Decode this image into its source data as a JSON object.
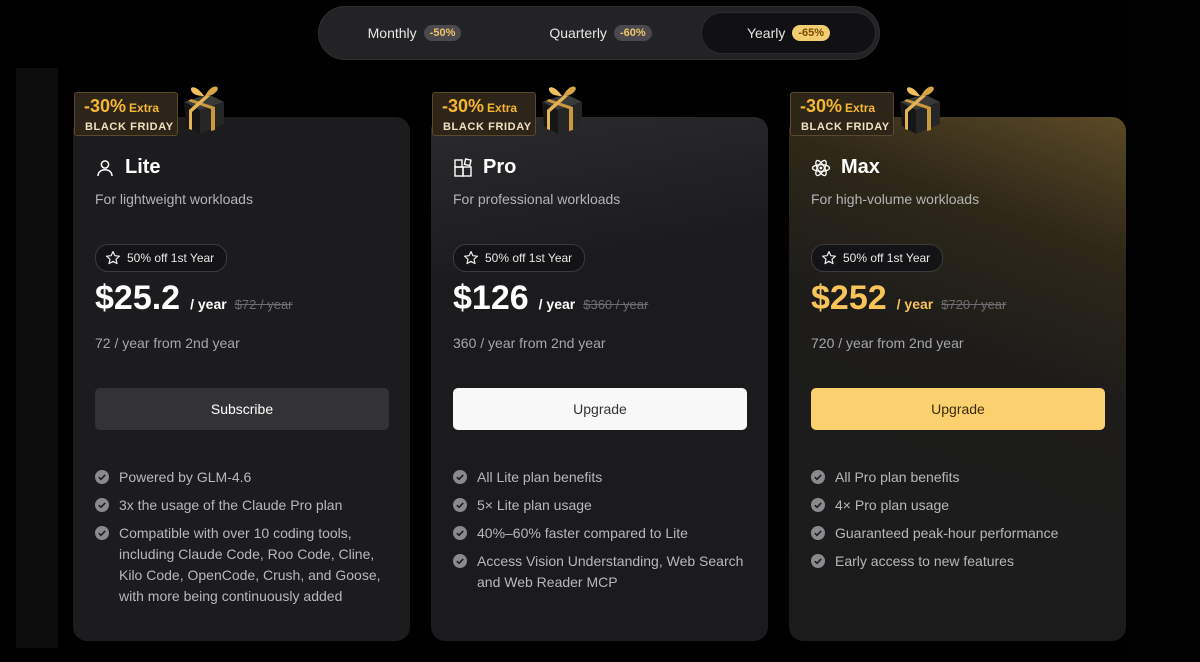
{
  "billing_toggle": {
    "options": [
      {
        "label": "Monthly",
        "discount": "-50%"
      },
      {
        "label": "Quarterly",
        "discount": "-60%"
      },
      {
        "label": "Yearly",
        "discount": "-65%"
      }
    ],
    "selected": "Yearly"
  },
  "promo": {
    "percent": "-30%",
    "extra": "Extra",
    "event": "BLACK FRIDAY"
  },
  "plans": [
    {
      "name": "Lite",
      "icon": "user-icon",
      "description": "For lightweight workloads",
      "badge": "50% off 1st Year",
      "price": "$25.2",
      "period": "/ year",
      "old_price": "$72 / year",
      "renewal": "72 / year from 2nd year",
      "cta": "Subscribe",
      "features": [
        "Powered by GLM-4.6",
        "3x the usage of the Claude Pro plan",
        "Compatible with over 10 coding tools, including Claude Code, Roo Code, Cline, Kilo Code, OpenCode, Crush, and Goose, with more being continuously added"
      ]
    },
    {
      "name": "Pro",
      "icon": "apps-icon",
      "description": "For professional workloads",
      "badge": "50% off 1st Year",
      "price": "$126",
      "period": "/ year",
      "old_price": "$360 / year",
      "renewal": "360 / year from 2nd year",
      "cta": "Upgrade",
      "features": [
        "All Lite plan benefits",
        "5× Lite plan usage",
        "40%–60% faster compared to Lite",
        "Access Vision Understanding, Web Search and Web Reader MCP"
      ]
    },
    {
      "name": "Max",
      "icon": "atom-icon",
      "description": "For high-volume workloads",
      "badge": "50% off 1st Year",
      "price": "$252",
      "period": "/ year",
      "old_price": "$720 / year",
      "renewal": "720 / year from 2nd year",
      "cta": "Upgrade",
      "features": [
        "All Pro plan benefits",
        "4× Pro plan usage",
        "Guaranteed peak-hour performance",
        "Early access to new features"
      ]
    }
  ],
  "colors": {
    "accent_gold": "#f7c45a",
    "promo_orange": "#f6b733",
    "background": "#000000"
  }
}
